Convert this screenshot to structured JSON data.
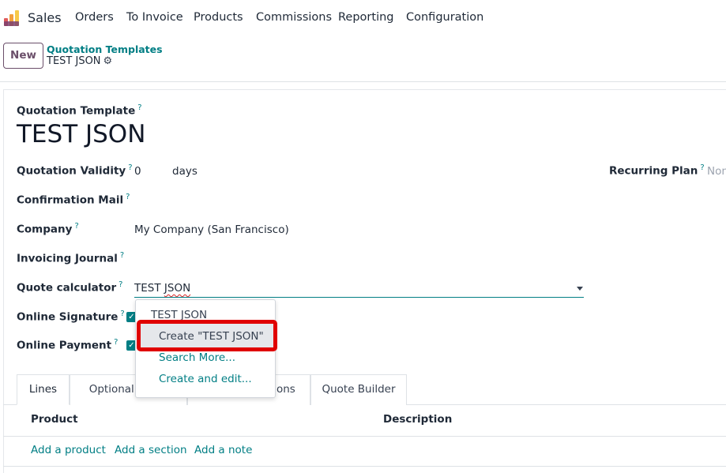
{
  "nav": {
    "app": "Sales",
    "items": [
      "Orders",
      "To Invoice",
      "Products",
      "Commissions",
      "Reporting",
      "Configuration"
    ]
  },
  "control": {
    "new_label": "New",
    "breadcrumb_parent": "Quotation Templates",
    "breadcrumb_current": "TEST JSON"
  },
  "form": {
    "title_label": "Quotation Template",
    "title": "TEST JSON",
    "tooltip_mark": "?",
    "fields": {
      "validity_label": "Quotation Validity",
      "validity_value": "0",
      "validity_unit": "days",
      "recurring_label": "Recurring Plan",
      "recurring_value": "Non",
      "mail_label": "Confirmation Mail",
      "company_label": "Company",
      "company_value": "My Company (San Francisco)",
      "journal_label": "Invoicing Journal",
      "calculator_label": "Quote calculator",
      "calculator_value_a": "TEST ",
      "calculator_value_b": "JSON",
      "signature_label": "Online Signature",
      "payment_label": "Online Payment"
    }
  },
  "dropdown": {
    "items": [
      "TEST JSON",
      "Create \"TEST JSON\"",
      "Search More...",
      "Create and edit..."
    ]
  },
  "tabs": {
    "lines": "Lines",
    "optional": "Optional P",
    "options_partial": "ions",
    "quote_builder": "Quote Builder"
  },
  "table": {
    "col_product": "Product",
    "col_description": "Description",
    "add_product": "Add a product",
    "add_section": "Add a section",
    "add_note": "Add a note"
  },
  "colors": {
    "accent": "#017e84",
    "primary": "#6b4f6a",
    "highlight": "#e00000"
  }
}
